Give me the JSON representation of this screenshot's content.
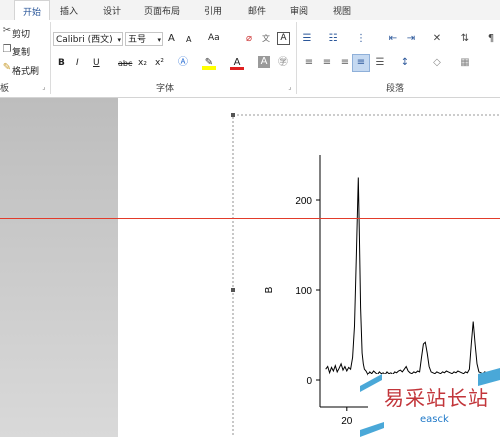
{
  "ribbon_tabs": [
    "开始",
    "插入",
    "设计",
    "页面布局",
    "引用",
    "邮件",
    "审阅",
    "视图"
  ],
  "clipboard": {
    "cut": "剪切",
    "copy": "复制",
    "format_painter": "格式刷",
    "group_label": "板"
  },
  "font": {
    "family": "Calibri (西文)",
    "size": "五号",
    "grow": "A",
    "shrink": "A",
    "change_case": "Aa",
    "bold": "B",
    "italic": "I",
    "underline": "U",
    "strike": "abc",
    "subscript": "x₂",
    "superscript": "x²",
    "group_label": "字体"
  },
  "paragraph": {
    "group_label": "段落"
  },
  "chart_data": {
    "type": "line",
    "xlabel": "",
    "ylabel": "B",
    "x_ticks": [
      20
    ],
    "y_ticks": [
      0,
      100,
      200
    ],
    "ylim": [
      -30,
      250
    ],
    "xlim": [
      13,
      60
    ],
    "series": [
      {
        "x": [
          14.5,
          15,
          15.5,
          16,
          16.5,
          17,
          17.5,
          18,
          18.5,
          19,
          19.5,
          20,
          20.5,
          21,
          21.5,
          22,
          22.5,
          23,
          23.3,
          23.6,
          24,
          24.3,
          24.6,
          25,
          25.5,
          26,
          26.5,
          27,
          27.5,
          28,
          28.5,
          29,
          29.5,
          30,
          30.5,
          31,
          31.5,
          32,
          32.5,
          33,
          33.5,
          34,
          34.5,
          35,
          35.5,
          36,
          36.5,
          37,
          37.5,
          38,
          38.5,
          39,
          39.5,
          40,
          40.5,
          41,
          41.5,
          42,
          42.5,
          43,
          43.5,
          44,
          44.5,
          45,
          45.5,
          46,
          46.5,
          47,
          47.5,
          48,
          48.5,
          49,
          49.5,
          50,
          50.5,
          51,
          51.5,
          52,
          52.5,
          53,
          53.5,
          54,
          54.5,
          55,
          55.5,
          56,
          56.5,
          57,
          57.5,
          58,
          58.5,
          59,
          59.5
        ],
        "y": [
          12,
          15,
          8,
          14,
          10,
          16,
          9,
          13,
          18,
          11,
          15,
          10,
          14,
          12,
          25,
          60,
          140,
          225,
          160,
          80,
          30,
          18,
          12,
          10,
          6,
          9,
          7,
          10,
          8,
          6,
          9,
          7,
          8,
          6,
          9,
          7,
          8,
          6,
          9,
          8,
          10,
          11,
          9,
          12,
          15,
          10,
          8,
          7,
          9,
          8,
          10,
          9,
          25,
          40,
          42,
          30,
          15,
          9,
          8,
          7,
          9,
          8,
          7,
          9,
          8,
          10,
          9,
          8,
          7,
          9,
          8,
          10,
          9,
          8,
          7,
          9,
          8,
          12,
          40,
          65,
          40,
          18,
          9,
          8,
          7,
          9,
          8,
          7,
          9,
          8,
          7,
          9,
          8
        ]
      }
    ]
  },
  "watermark": {
    "text": "易采站长站",
    "url": "easck"
  },
  "colors": {
    "accent": "#2b579a",
    "ruler_line": "#e23b2a",
    "watermark_red": "#c2353a",
    "watermark_blue": "#1e78c8"
  }
}
